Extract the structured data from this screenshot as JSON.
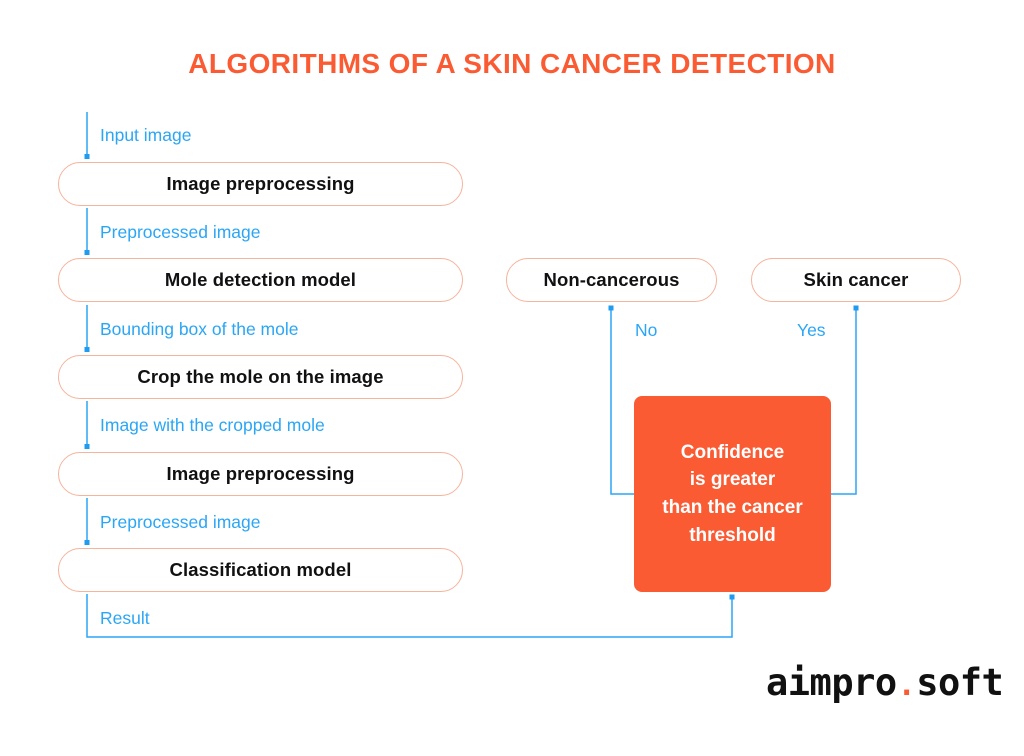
{
  "title": "ALGORITHMS OF A SKIN CANCER DETECTION",
  "colors": {
    "accent_orange": "#FB5B33",
    "pill_border": "#F6B39D",
    "connector_blue": "#2BA6F5",
    "box_text": "#111111",
    "background": "#FFFFFF"
  },
  "flow": {
    "steps": [
      {
        "id": "image-preprocessing-1",
        "label": "Image preprocessing"
      },
      {
        "id": "mole-detection-model",
        "label": "Mole detection model"
      },
      {
        "id": "crop-the-mole",
        "label": "Crop the mole on the image"
      },
      {
        "id": "image-preprocessing-2",
        "label": "Image preprocessing"
      },
      {
        "id": "classification-model",
        "label": "Classification model"
      }
    ],
    "edge_labels": [
      {
        "id": "input-image",
        "label": "Input image"
      },
      {
        "id": "preprocessed-image-1",
        "label": "Preprocessed image"
      },
      {
        "id": "bounding-box-of-mole",
        "label": "Bounding box of the mole"
      },
      {
        "id": "image-with-cropped-mole",
        "label": "Image with the cropped mole"
      },
      {
        "id": "preprocessed-image-2",
        "label": "Preprocessed image"
      },
      {
        "id": "result",
        "label": "Result"
      }
    ]
  },
  "decision": {
    "question_lines": [
      "Confidence",
      "is greater",
      "than the cancer",
      "threshold"
    ],
    "question_text": "Confidence is greater than the cancer threshold",
    "branches": [
      {
        "id": "branch-no",
        "label": "No",
        "outcome": "Non-cancerous"
      },
      {
        "id": "branch-yes",
        "label": "Yes",
        "outcome": "Skin cancer"
      }
    ],
    "outcomes": [
      {
        "id": "outcome-non-cancerous",
        "label": "Non-cancerous"
      },
      {
        "id": "outcome-skin-cancer",
        "label": "Skin cancer"
      }
    ]
  },
  "logo": {
    "part1": "aimpro",
    "dot": ".",
    "part2": "soft",
    "full": "aimpro.soft"
  }
}
